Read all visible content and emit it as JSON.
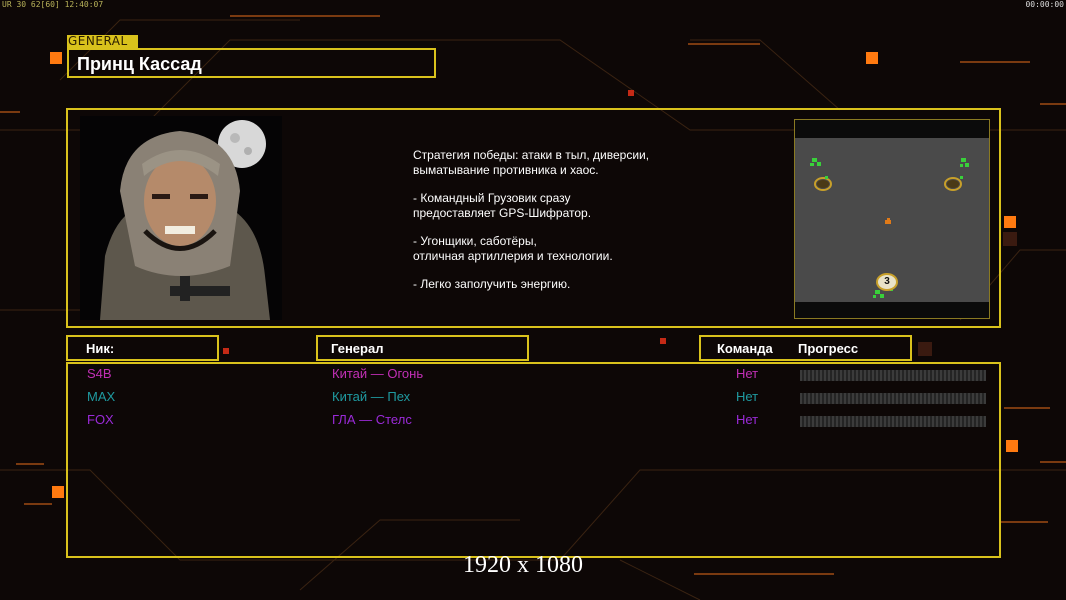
{
  "hud": {
    "left": "UR 30 62[60] 12:40:07",
    "right": "00:00:00"
  },
  "general": {
    "tag": "GENERAL",
    "name": "Принц Кассад",
    "description": [
      "Стратегия победы: атаки в тыл, диверсии,\n выматывание противника и хаос.",
      "- Командный Грузовик сразу\nпредоставляет GPS-Шифратор.",
      "- Угонщики, саботёры,\nотличная артиллерия и технологии.",
      "- Легко заполучить энергию."
    ]
  },
  "map": {
    "marker_label": "3"
  },
  "headers": {
    "nick": "Ник:",
    "general": "Генерал",
    "team": "Команда",
    "progress": "Прогресс"
  },
  "players": [
    {
      "nick": "S4B",
      "general": "Китай — Огонь",
      "team": "Нет",
      "progress": 0,
      "color": "#c22fb6"
    },
    {
      "nick": "MAX",
      "general": "Китай — Пех",
      "team": "Нет",
      "progress": 0,
      "color": "#1f9aa0"
    },
    {
      "nick": "FOX",
      "general": "ГЛА — Стелс",
      "team": "Нет",
      "progress": 0,
      "color": "#9a2ad8"
    }
  ],
  "resolution": "1920 x 1080",
  "colors": {
    "frame": "#d9c21c",
    "accent": "#ff7a10"
  }
}
